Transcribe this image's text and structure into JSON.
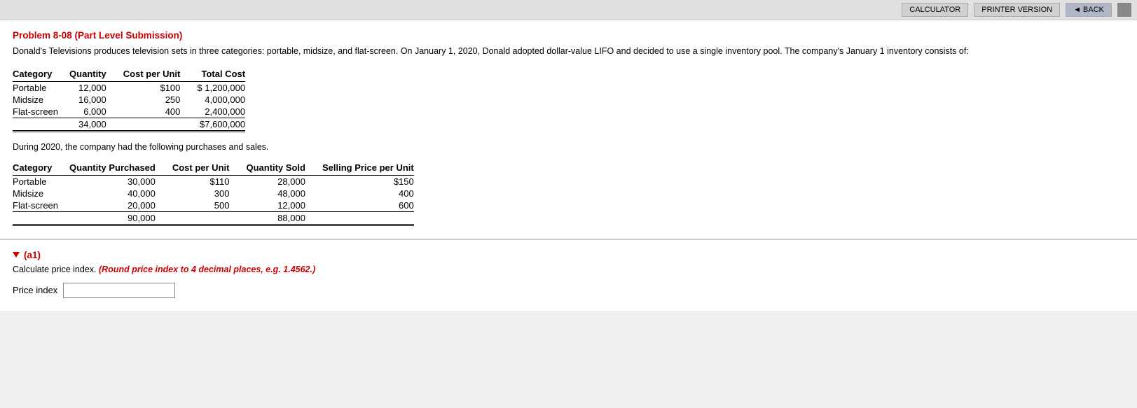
{
  "topbar": {
    "calculator_label": "CALCULATOR",
    "printer_label": "PRINTER VERSION",
    "back_label": "◄ BACK"
  },
  "problem": {
    "title": "Problem 8-08 (Part Level Submission)",
    "description": "Donald's Televisions produces television sets in three categories: portable, midsize, and flat-screen. On January 1, 2020, Donald adopted dollar-value LIFO and decided to use a single inventory pool. The company's January 1 inventory consists of:",
    "inventory_table": {
      "headers": [
        "Category",
        "Quantity",
        "Cost per Unit",
        "Total Cost"
      ],
      "rows": [
        {
          "category": "Portable",
          "quantity": "12,000",
          "cost_per_unit": "$100",
          "total_cost": "$ 1,200,000"
        },
        {
          "category": "Midsize",
          "quantity": "16,000",
          "cost_per_unit": "250",
          "total_cost": "4,000,000"
        },
        {
          "category": "Flat-screen",
          "quantity": "6,000",
          "cost_per_unit": "400",
          "total_cost": "2,400,000"
        }
      ],
      "total_row": {
        "quantity": "34,000",
        "total_cost": "$7,600,000"
      }
    },
    "purchases_text": "During 2020, the company had the following purchases and sales.",
    "purchases_table": {
      "headers": {
        "category": "Category",
        "qty_purchased": "Quantity Purchased",
        "cost_per_unit": "Cost per Unit",
        "qty_sold": "Quantity Sold",
        "selling_price": "Selling Price per Unit"
      },
      "rows": [
        {
          "category": "Portable",
          "qty_purchased": "30,000",
          "cost_per_unit": "$110",
          "qty_sold": "28,000",
          "selling_price": "$150"
        },
        {
          "category": "Midsize",
          "qty_purchased": "40,000",
          "cost_per_unit": "300",
          "qty_sold": "48,000",
          "selling_price": "400"
        },
        {
          "category": "Flat-screen",
          "qty_purchased": "20,000",
          "cost_per_unit": "500",
          "qty_sold": "12,000",
          "selling_price": "600"
        }
      ],
      "total_row": {
        "qty_purchased": "90,000",
        "qty_sold": "88,000"
      }
    }
  },
  "answer": {
    "part_label": "(a1)",
    "instruction_plain": "Calculate price index.",
    "instruction_italic": "(Round price index to 4 decimal places, e.g. 1.4562.)",
    "price_index_label": "Price index",
    "price_index_value": ""
  }
}
